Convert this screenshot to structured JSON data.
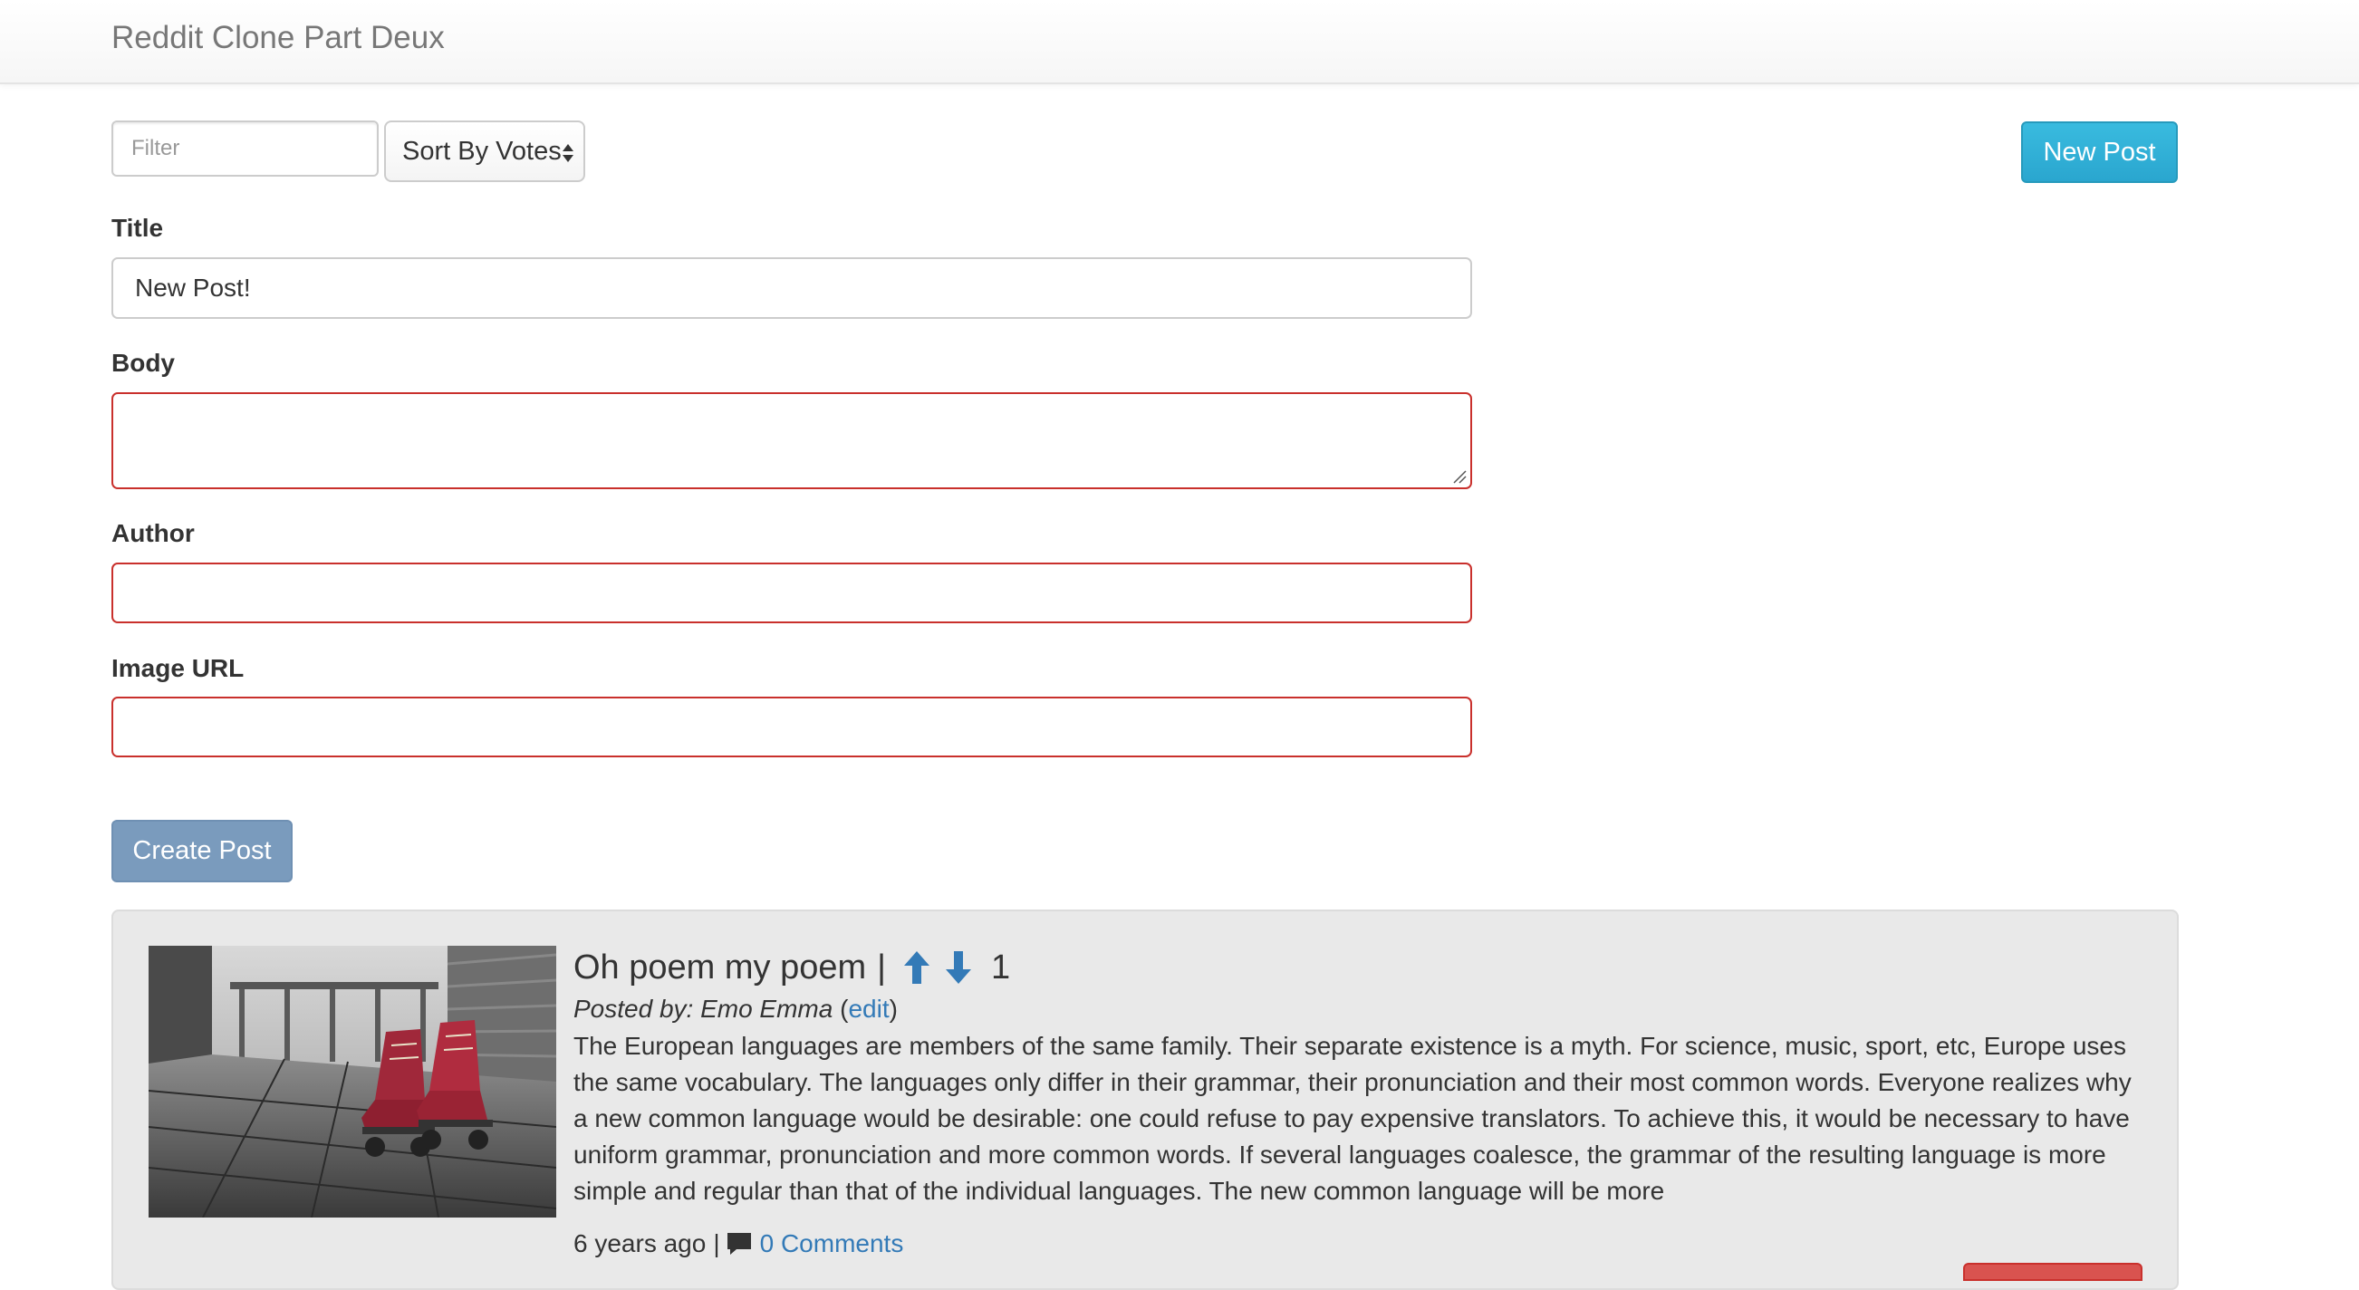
{
  "navbar": {
    "brand": "Reddit Clone Part Deux"
  },
  "toolbar": {
    "filter_placeholder": "Filter",
    "sort_label": "Sort By Votes",
    "new_post_label": "New Post"
  },
  "form": {
    "title_label": "Title",
    "title_value": "New Post!",
    "body_label": "Body",
    "body_value": "",
    "author_label": "Author",
    "author_value": "",
    "image_url_label": "Image URL",
    "image_url_value": "",
    "submit_label": "Create Post"
  },
  "post": {
    "title": "Oh poem my poem",
    "title_separator": "|",
    "votes": "1",
    "posted_by_prefix": "Posted by: Emo Emma",
    "edit_label": "edit",
    "body": "The European languages are members of the same family. Their separate existence is a myth. For science, music, sport, etc, Europe uses the same vocabulary. The languages only differ in their grammar, their pronunciation and their most common words. Everyone realizes why a new common language would be desirable: one could refuse to pay expensive translators. To achieve this, it would be necessary to have uniform grammar, pronunciation and more common words. If several languages coalesce, the grammar of the resulting language is more simple and regular than that of the individual languages. The new common language will be more",
    "age": "6 years ago",
    "meta_separator": "|",
    "comments_label": "0 Comments"
  },
  "colors": {
    "info": "#31b0d5",
    "primary_disabled": "#7a9bbd",
    "error_border": "#c9302c",
    "link": "#337ab7",
    "vote_arrow": "#337ab7"
  },
  "icons": {
    "upvote": "arrow-up-icon",
    "downvote": "arrow-down-icon",
    "comments": "comment-icon",
    "sort": "sort-arrows-icon"
  }
}
